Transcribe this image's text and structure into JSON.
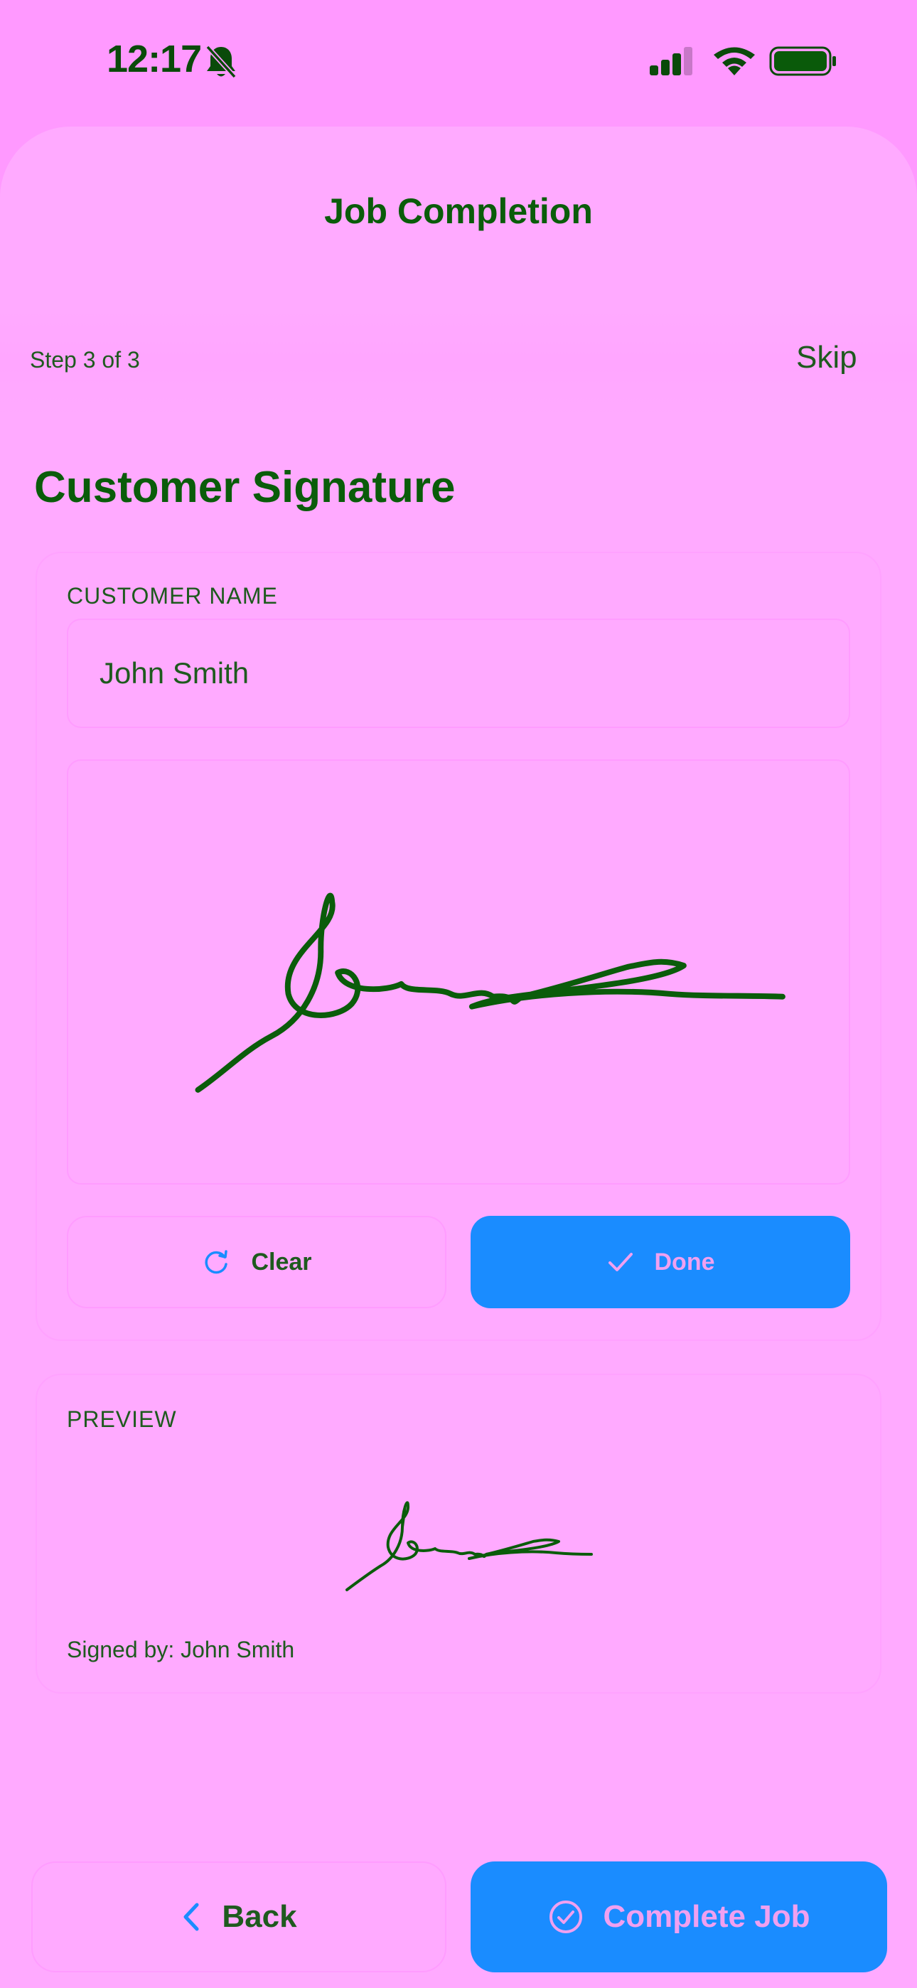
{
  "status_bar": {
    "time": "12:17",
    "icons": [
      "bell-slash-icon",
      "signal-icon",
      "wifi-icon",
      "battery-icon"
    ]
  },
  "header": {
    "title": "Job Completion"
  },
  "steps": {
    "progress_text": "Step 3 of 3",
    "skip_label": "Skip"
  },
  "signature_section": {
    "title": "Customer Signature",
    "name_label": "CUSTOMER NAME",
    "name_value": "John Smith",
    "clear_label": "Clear",
    "done_label": "Done"
  },
  "preview": {
    "label": "PREVIEW",
    "signed_by": "Signed by: John Smith"
  },
  "footer": {
    "back_label": "Back",
    "complete_label": "Complete Job"
  },
  "colors": {
    "background": "#ff99ff",
    "sheet": "#ffaaff",
    "accent": "#1a8cff",
    "text": "#0a5c0a"
  }
}
